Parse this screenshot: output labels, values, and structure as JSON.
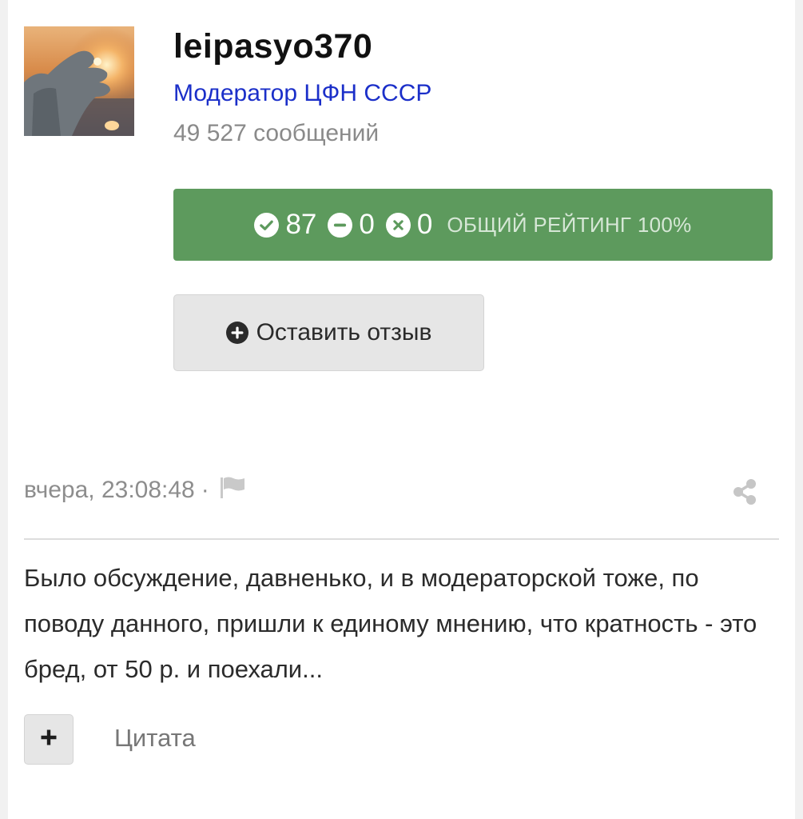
{
  "author": {
    "username": "leipasyo370",
    "group": "Модератор ЦФН СССР",
    "post_count": "49 527 сообщений",
    "avatar_icon": "avatar-photo"
  },
  "rating": {
    "positive": "87",
    "neutral": "0",
    "negative": "0",
    "label": "ОБЩИЙ РЕЙТИНГ 100%",
    "color": "#5d9a5d"
  },
  "feedback_button": {
    "label": "Оставить отзыв",
    "icon": "plus-circle-icon"
  },
  "post": {
    "timestamp": "вчера, 23:08:48",
    "separator": "·",
    "text": "Было обсуждение, давненько, и в модераторской тоже, по поводу данного, пришли к единому мнению, что кратность - это бред, от 50 р. и поехали..."
  },
  "actions": {
    "quote_label": "Цитата",
    "plus_icon": "plus-icon",
    "share_icon": "share-icon",
    "flag_icon": "flag-icon"
  }
}
